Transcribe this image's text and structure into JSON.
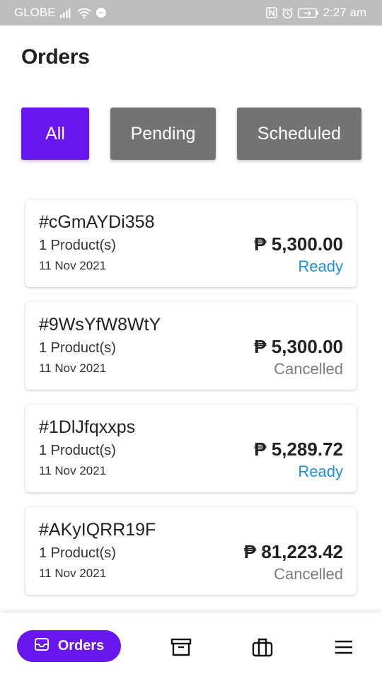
{
  "status_bar": {
    "carrier": "GLOBE",
    "time": "2:27 am"
  },
  "page": {
    "title": "Orders"
  },
  "tabs": [
    {
      "label": "All",
      "active": true
    },
    {
      "label": "Pending",
      "active": false
    },
    {
      "label": "Scheduled",
      "active": false
    }
  ],
  "orders": [
    {
      "id": "#cGmAYDi358",
      "products": "1 Product(s)",
      "date": "11 Nov 2021",
      "amount": "₱ 5,300.00",
      "status": "Ready"
    },
    {
      "id": "#9WsYfW8WtY",
      "products": "1 Product(s)",
      "date": "11 Nov 2021",
      "amount": "₱ 5,300.00",
      "status": "Cancelled"
    },
    {
      "id": "#1DlJfqxxps",
      "products": "1 Product(s)",
      "date": "11 Nov 2021",
      "amount": "₱ 5,289.72",
      "status": "Ready"
    },
    {
      "id": "#AKyIQRR19F",
      "products": "1 Product(s)",
      "date": "11 Nov 2021",
      "amount": "₱ 81,223.42",
      "status": "Cancelled"
    }
  ],
  "bottom_nav": {
    "orders_label": "Orders",
    "icons": [
      "inbox-icon",
      "archive-icon",
      "briefcase-icon",
      "menu-icon"
    ]
  },
  "colors": {
    "accent": "#6a16ee",
    "inactive_tab": "#737373",
    "status_ready": "#1e8fd6",
    "status_cancelled": "#7c7c7c",
    "status_bar": "#bdbdbd"
  }
}
